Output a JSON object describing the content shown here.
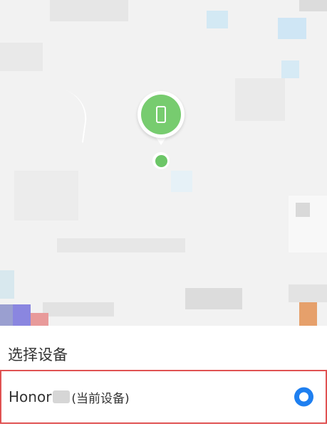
{
  "sheet": {
    "title": "选择设备"
  },
  "devices": [
    {
      "name": "Honor",
      "suffix": "(当前设备)",
      "selected": true
    }
  ],
  "map": {
    "marker_icon": "phone-icon",
    "location_dot": "current-location-dot"
  },
  "colors": {
    "marker_green": "#77cc6f",
    "radio_blue": "#1e7ff0",
    "highlight_red": "#e05252"
  }
}
